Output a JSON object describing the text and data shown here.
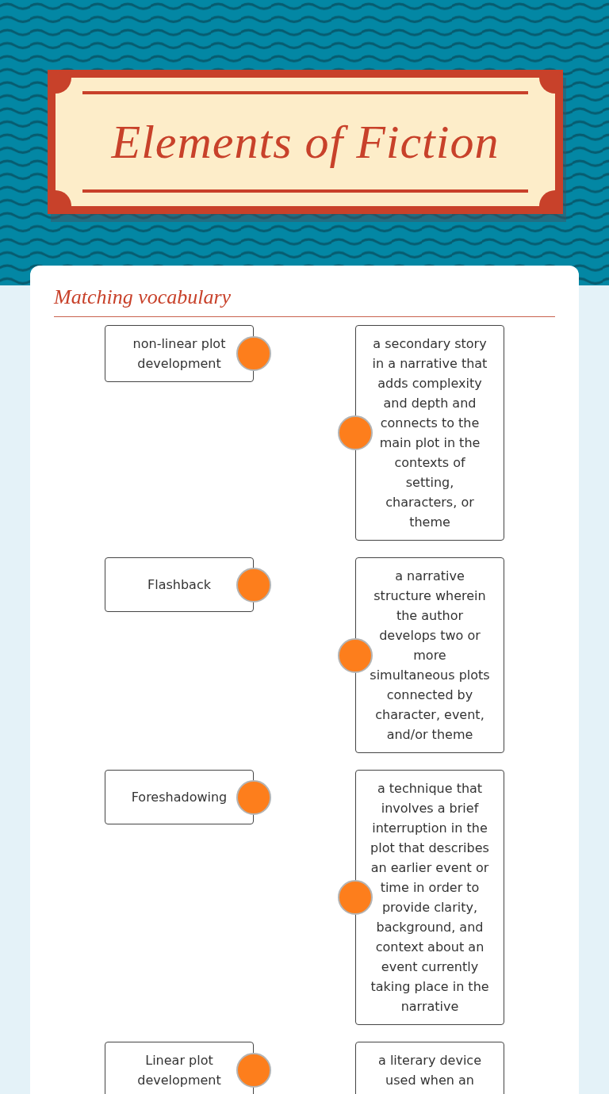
{
  "title": "Elements of Fiction",
  "section": {
    "heading": "Matching vocabulary"
  },
  "terms": [
    "non-linear plot development",
    "Flashback",
    "Foreshadowing",
    "Linear plot development"
  ],
  "definitions": [
    "a secondary story in a narrative that adds complexity and depth and connects to the main plot in the contexts of setting, characters, or theme",
    "a narrative structure wherein the author develops two or more simultaneous plots connected by character, event, and/or theme",
    "a technique that involves a brief interruption in the plot that describes an earlier event or time in order to provide clarity, background, and context about an event currently taking place in the narrative",
    "a literary device used when an"
  ],
  "last_definition_runs_past_frame": true
}
